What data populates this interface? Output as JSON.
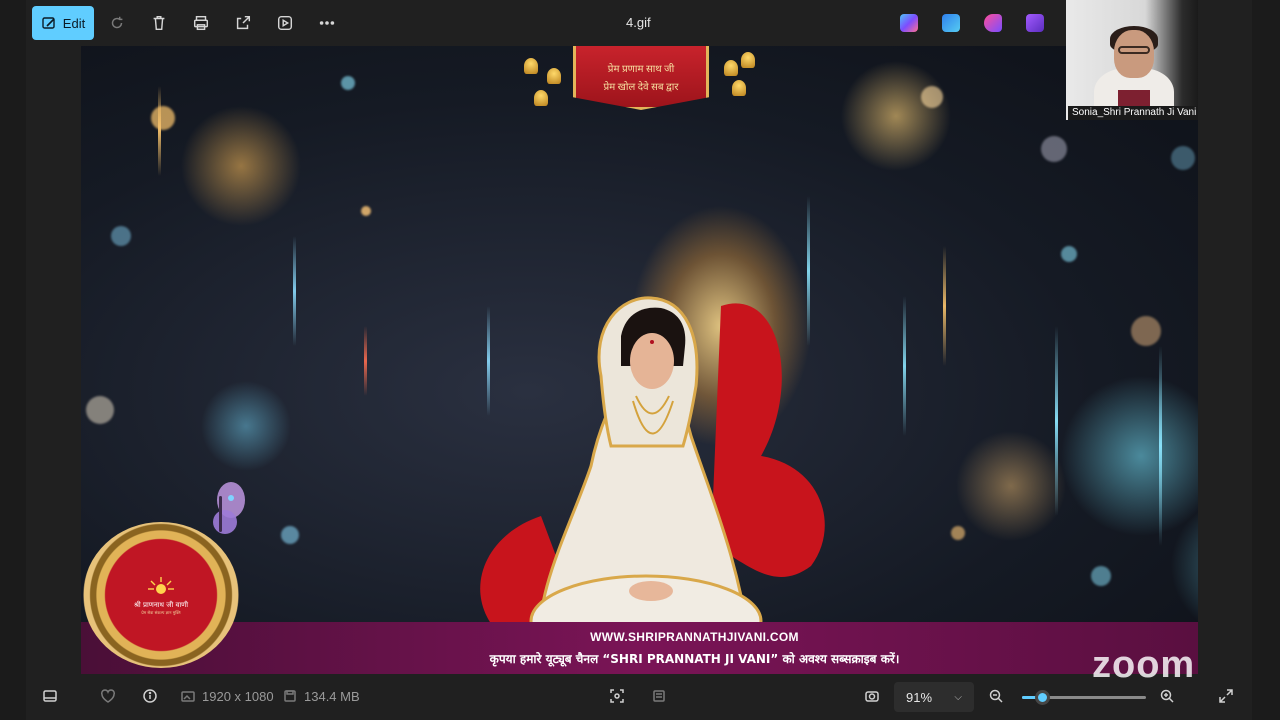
{
  "toolbar": {
    "edit_label": "Edit",
    "file_name": "4.gif",
    "icons": [
      "edit-icon",
      "rotate-icon",
      "delete-icon",
      "print-icon",
      "share-icon",
      "slideshow-icon",
      "more-icon"
    ],
    "apps": [
      {
        "name": "copilot-icon",
        "color": "#7a8cff"
      },
      {
        "name": "designer-icon",
        "color": "#3a8ef0"
      },
      {
        "name": "paint-icon",
        "color": "#e05ab0"
      },
      {
        "name": "clipchamp-icon",
        "color": "#8b4fd8"
      }
    ]
  },
  "image": {
    "banner_line1": "प्रेम प्रणाम साथ जी",
    "banner_line2": "प्रेम खोल देवे सब द्वार",
    "promo_url": "WWW.SHRIPRANNATHJIVANI.COM",
    "promo_message": "कृपया हमारे यूट्यूब चैनल “SHRI PRANNATH JI VANI” को अवश्य सब्सक्राइब करें।",
    "logo_label": "श्री प्राणनाथ जी वाणी",
    "logo_sub": "प्रेम सेवा संकल्प ज्ञान मुक्ति"
  },
  "participant": {
    "name": "Sonia_Shri Prannath Ji Vani"
  },
  "statusbar": {
    "dimensions": "1920 x 1080",
    "file_size": "134.4 MB",
    "zoom_value": "91%",
    "zoom_fraction": 0.16
  },
  "watermark": "zoom",
  "colors": {
    "accent": "#60cdff",
    "promo_bar": "#7a1456",
    "banner_red": "#c8232c"
  }
}
